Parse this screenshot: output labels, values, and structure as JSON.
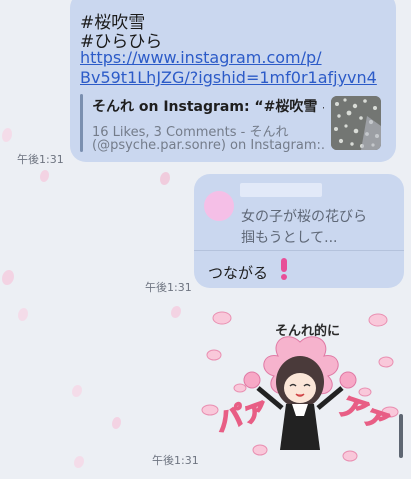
{
  "messages": [
    {
      "hashtags": [
        "#桜吹雪",
        "#ひらひら"
      ],
      "link_line1": "https://www.instagram.com/p/",
      "link_line2": "Bv59t1LhJZG/?igshid=1mf0r1afjyvn4",
      "preview_title": "そんれ on Instagram: “#桜吹雪 #...",
      "preview_desc_line1": "16 Likes, 3 Comments - そんれ",
      "preview_desc_line2": "(@psyche.par.sonre) on Instagram:...",
      "time": "午後1:31"
    },
    {
      "reply_quote_line1": "女の子が桜の花びら",
      "reply_quote_line2": "掴もうとして...",
      "text": "つながる",
      "time": "午後1:31"
    },
    {
      "sticker_caption": "そんれ的に",
      "sticker_sfx_left": "パァ",
      "sticker_sfx_right": "アァ",
      "time": "午後1:31"
    }
  ],
  "colors": {
    "bubble": "#cad7ef",
    "link": "#2c5bc8",
    "background": "#eceff4",
    "accent_pink": "#e85e85"
  },
  "icons": [
    "pink-exclamation-icon",
    "thumbnail-image",
    "sticker-girl-image"
  ]
}
